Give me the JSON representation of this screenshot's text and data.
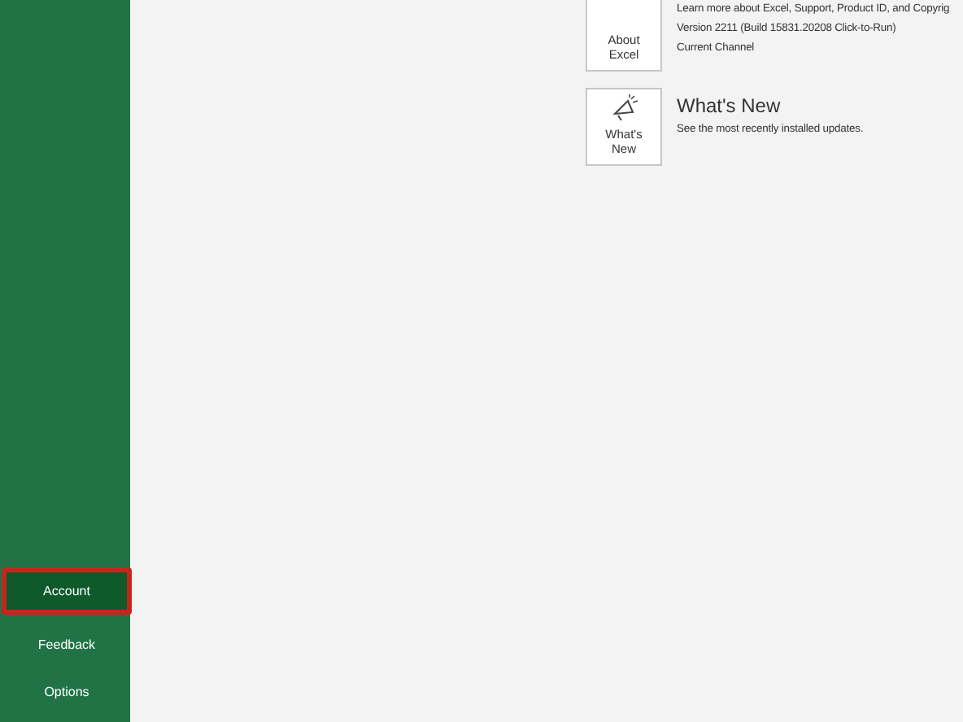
{
  "sidebar": {
    "items": [
      {
        "label": "Account",
        "selected": true,
        "highlighted": true
      },
      {
        "label": "Feedback",
        "selected": false,
        "highlighted": false
      },
      {
        "label": "Options",
        "selected": false,
        "highlighted": false
      }
    ]
  },
  "product_info": [
    {
      "kind": "about",
      "button": "About Excel",
      "lines": [
        "Learn more about Excel, Support, Product ID, and Copyrig",
        "Version 2211 (Build 15831.20208 Click-to-Run)",
        "Current Channel"
      ]
    },
    {
      "kind": "whatsnew",
      "button": "What's New",
      "title": "What's New",
      "lines": [
        "See the most recently installed updates."
      ]
    }
  ]
}
